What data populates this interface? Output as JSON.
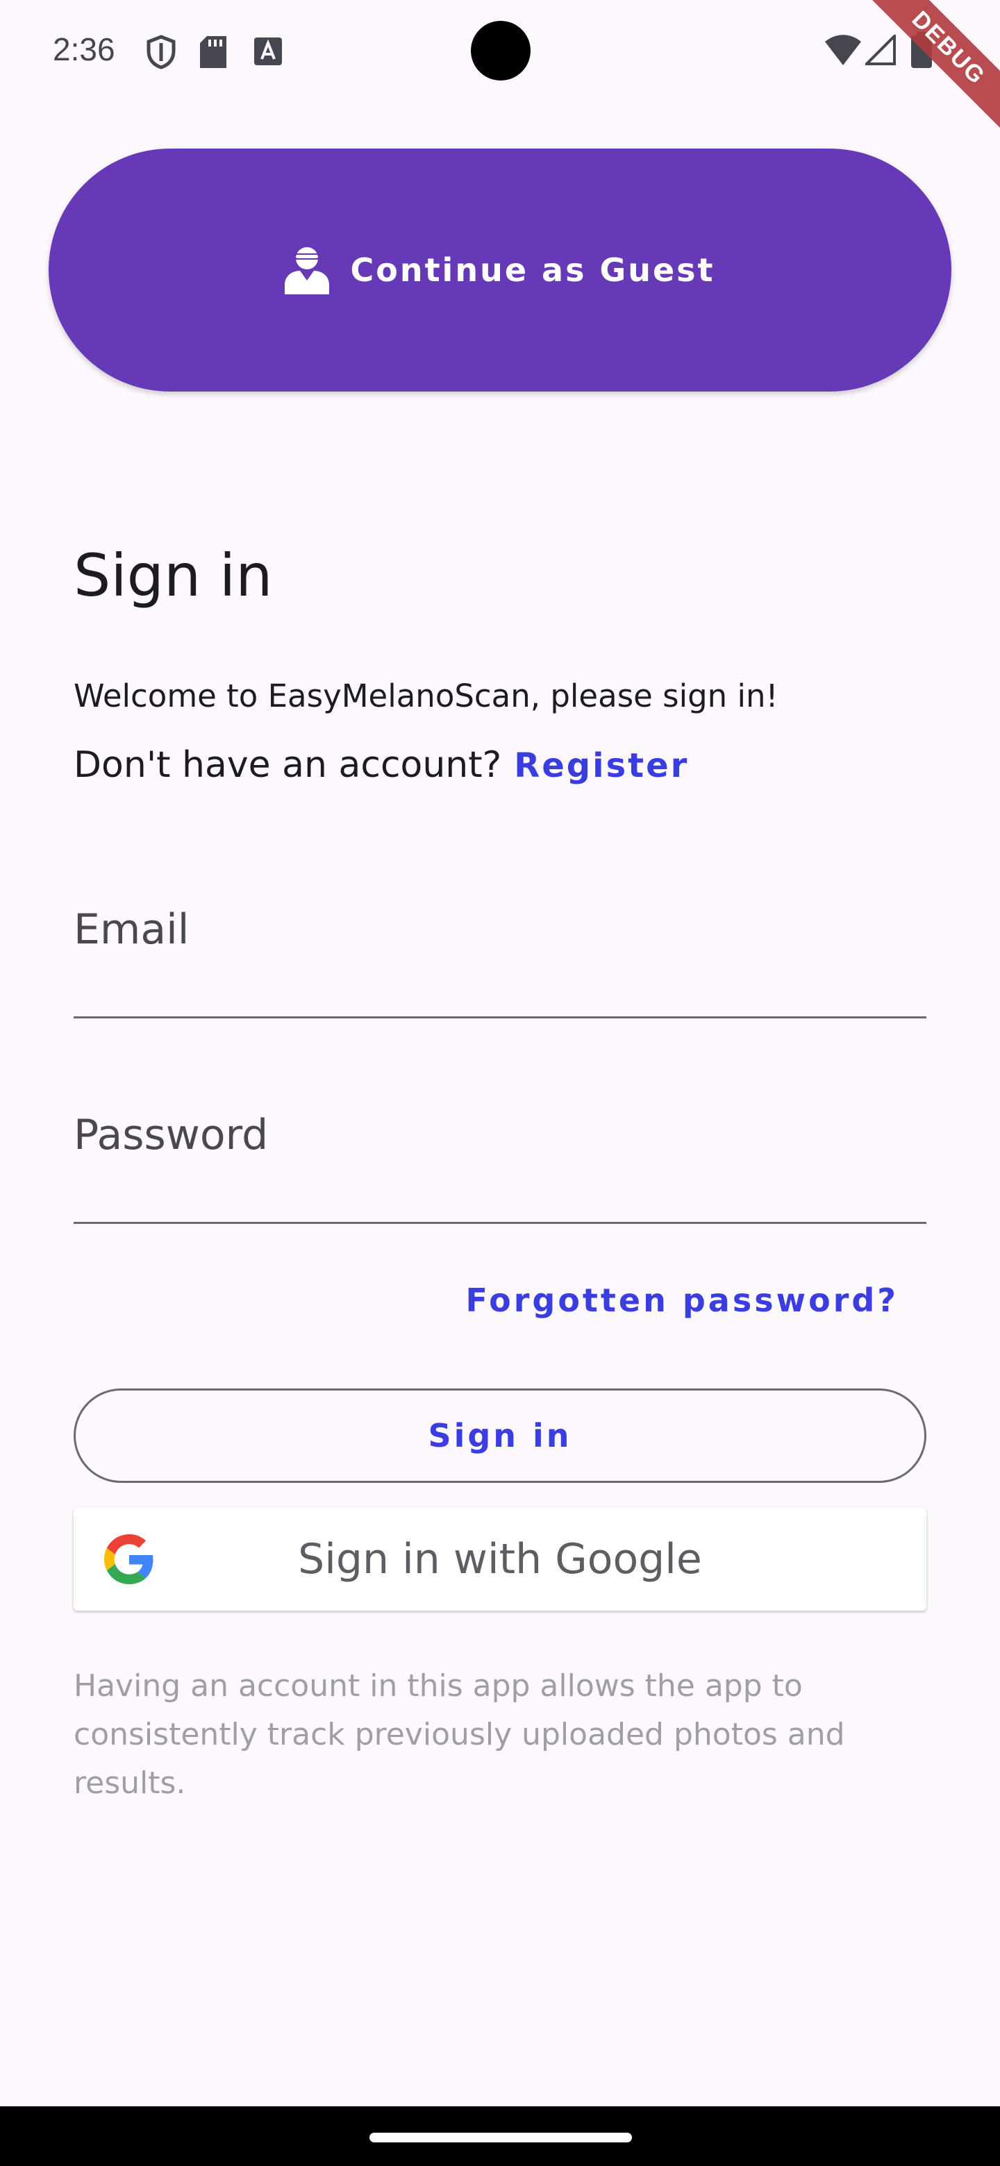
{
  "status_bar": {
    "time": "2:36",
    "icons": [
      "shield-icon",
      "sd-card-icon",
      "text-a-icon",
      "wifi-icon",
      "signal-icon",
      "battery-icon"
    ],
    "debug_label": "DEBUG"
  },
  "guest_button": {
    "label": "Continue as Guest",
    "icon": "incognito-user-icon",
    "color": "#6639b7"
  },
  "sign_in": {
    "title": "Sign in",
    "welcome": "Welcome to EasyMelanoScan, please sign in!",
    "no_account_text": "Don't have an account?",
    "register_label": "Register"
  },
  "form": {
    "email_label": "Email",
    "password_label": "Password",
    "forgot_label": "Forgotten password?",
    "submit_label": "Sign in",
    "google_label": "Sign in with Google"
  },
  "info": {
    "text": "Having an account in this app allows the app to consistently track previously uploaded photos and results."
  },
  "colors": {
    "background": "#fdf8fd",
    "link": "#3a3ee0",
    "primary": "#6639b7"
  }
}
